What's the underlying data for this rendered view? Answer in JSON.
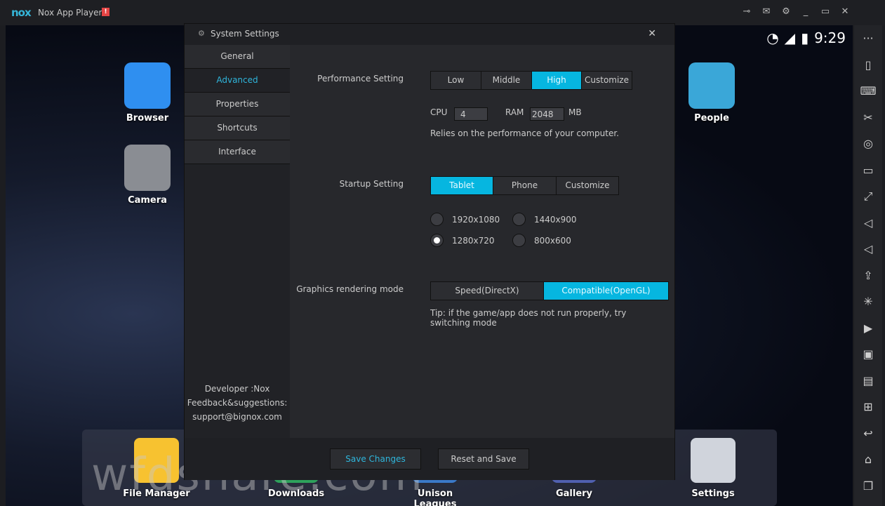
{
  "app": {
    "logo": "nox",
    "title": "Nox App Player",
    "alert": "!",
    "window_icons": [
      "pin-icon",
      "mail-icon",
      "gear-icon",
      "minimize-icon",
      "maximize-icon",
      "close-icon"
    ]
  },
  "status_bar": {
    "time": "9:29"
  },
  "desktop": [
    {
      "label": "Browser",
      "color": "#2f8ff0"
    },
    {
      "label": "Camera",
      "color": "#8a8d93"
    },
    {
      "label": "People",
      "color": "#3aa7d8"
    }
  ],
  "dock": [
    {
      "label": "File Manager",
      "color": "#f7c230"
    },
    {
      "label": "Downloads",
      "color": "#2ea25c"
    },
    {
      "label": "Unison Leagues",
      "color": "#3a79c8"
    },
    {
      "label": "Gallery",
      "color": "#5060b0"
    },
    {
      "label": "Settings",
      "color": "#d0d4dc"
    }
  ],
  "watermark": "wfdshare.com",
  "sidebar_icons": [
    "more-icon",
    "shake-icon",
    "keyboard-icon",
    "scissors-icon",
    "location-icon",
    "screen-icon",
    "fullscreen-icon",
    "volume-up-icon",
    "volume-down-icon",
    "apk-icon",
    "loading-icon",
    "macro-icon",
    "video-icon",
    "toolbox-icon",
    "multi-icon",
    "back-icon",
    "home-icon",
    "recent-icon"
  ],
  "dialog": {
    "title": "System Settings",
    "nav": [
      "General",
      "Advanced",
      "Properties",
      "Shortcuts",
      "Interface"
    ],
    "active_nav": "Advanced",
    "footer_info": [
      "Developer :Nox",
      "Feedback&suggestions:",
      "support@bignox.com"
    ],
    "performance": {
      "label": "Performance Setting",
      "options": [
        "Low",
        "Middle",
        "High",
        "Customize"
      ],
      "selected": "High",
      "cpu_label": "CPU",
      "cpu": "4",
      "ram_label": "RAM",
      "ram": "2048",
      "ram_unit": "MB",
      "note": "Relies on the performance of your computer."
    },
    "startup": {
      "label": "Startup Setting",
      "options": [
        "Tablet",
        "Phone",
        "Customize"
      ],
      "selected": "Tablet",
      "resolutions": [
        "1920x1080",
        "1440x900",
        "1280x720",
        "800x600"
      ],
      "selected_resolution": "1280x720"
    },
    "graphics": {
      "label": "Graphics rendering mode",
      "options": [
        "Speed(DirectX)",
        "Compatible(OpenGL)"
      ],
      "selected": "Compatible(OpenGL)",
      "tip": "Tip: if the game/app does not run properly, try switching mode"
    },
    "save_label": "Save Changes",
    "reset_label": "Reset and Save"
  },
  "colors": {
    "accent": "#06b6e0",
    "dialog_bg": "#27282c"
  }
}
